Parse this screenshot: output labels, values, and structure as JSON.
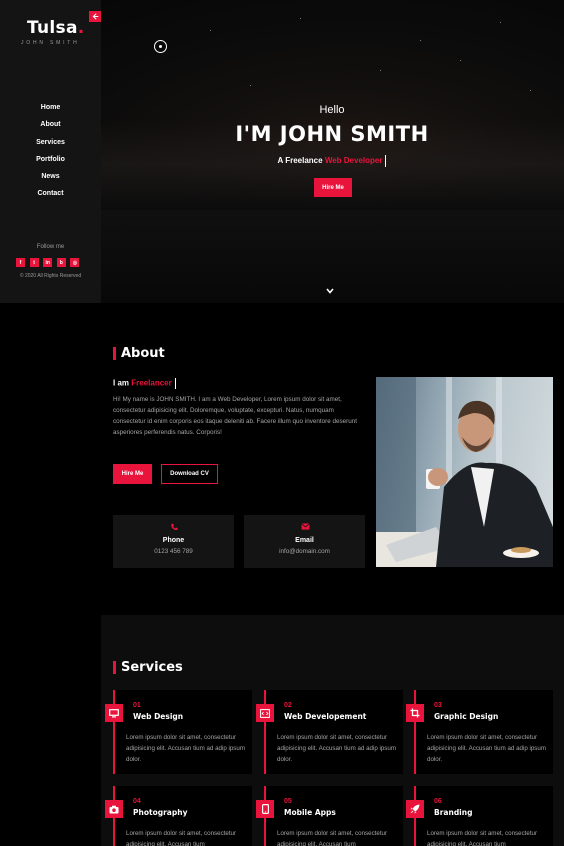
{
  "brand": {
    "name": "Tulsa",
    "dot": ".",
    "subtitle": "JOHN SMITH",
    "toggle_icon": "arrow-left-icon"
  },
  "nav": {
    "items": [
      "Home",
      "About",
      "Services",
      "Portfolio",
      "News",
      "Contact"
    ]
  },
  "sidebar": {
    "follow_label": "Follow me",
    "socials": [
      {
        "icon": "facebook-icon",
        "glyph": "f"
      },
      {
        "icon": "twitter-icon",
        "glyph": "t"
      },
      {
        "icon": "linkedin-icon",
        "glyph": "in"
      },
      {
        "icon": "behance-icon",
        "glyph": "b"
      },
      {
        "icon": "instagram-icon",
        "glyph": "◎"
      }
    ],
    "copyright": "© 2020 All Rights Reserved"
  },
  "hero": {
    "greeting": "Hello",
    "title": "I'M JOHN SMITH",
    "subtitle_prefix": "A Freelance",
    "subtitle_highlight": "Web Developer",
    "button": "Hire Me"
  },
  "about": {
    "heading": "About",
    "iam_prefix": "I am",
    "iam_highlight": "Freelancer",
    "text": "Hi! My name is JOHN SMITH. I am a Web Developer, Lorem ipsum dolor sit amet, consectetur adipisicing elit. Doloremque, voluptate, excepturi. Natus, numquam consectetur id enim corporis eos itaque deleniti ab. Facere illum quo inventore deserunt asperiores perferendis natus. Corporis!",
    "hire_button": "Hire Me",
    "cv_button": "Download CV",
    "phone_label": "Phone",
    "phone_value": "0123 456 789",
    "email_label": "Email",
    "email_value": "info@domain.com"
  },
  "services": {
    "heading": "Services",
    "items": [
      {
        "num": "01",
        "name": "Web Design",
        "icon": "monitor-icon",
        "desc": "Lorem ipsum dolor sit amet, consectetur adipisicing elit. Accusan tium ad adip ipsum dolor."
      },
      {
        "num": "02",
        "name": "Web Developement",
        "icon": "code-icon",
        "desc": "Lorem ipsum dolor sit amet, consectetur adipisicing elit. Accusan tium ad adip ipsum dolor."
      },
      {
        "num": "03",
        "name": "Graphic Design",
        "icon": "crop-icon",
        "desc": "Lorem ipsum dolor sit amet, consectetur adipisicing elit. Accusan tium ad adip ipsum dolor."
      },
      {
        "num": "04",
        "name": "Photography",
        "icon": "camera-icon",
        "desc": "Lorem ipsum dolor sit amet, consectetur adipisicing elit. Accusan tium"
      },
      {
        "num": "05",
        "name": "Mobile Apps",
        "icon": "mobile-icon",
        "desc": "Lorem ipsum dolor sit amet, consectetur adipisicing elit. Accusan tium"
      },
      {
        "num": "06",
        "name": "Branding",
        "icon": "rocket-icon",
        "desc": "Lorem ipsum dolor sit amet, consectetur adipisicing elit. Accusan tium"
      }
    ]
  },
  "colors": {
    "accent": "#e8143c",
    "sidebar": "#141414",
    "card": "#141414",
    "text_muted": "#a5a5a5"
  }
}
